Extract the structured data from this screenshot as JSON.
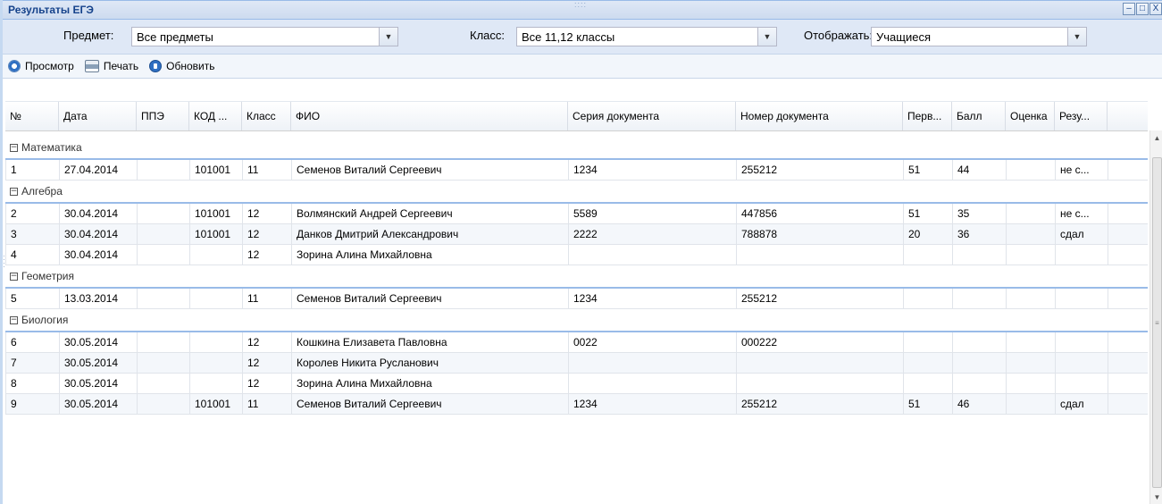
{
  "window": {
    "title": "Результаты ЕГЭ",
    "buttons": {
      "minimize": "–",
      "maximize": "□",
      "close": "X"
    }
  },
  "filters": {
    "subject_label": "Предмет:",
    "subject_value": "Все предметы",
    "class_label": "Класс:",
    "class_value": "Все 11,12 классы",
    "display_label": "Отображать:",
    "display_value": "Учащиеся"
  },
  "toolbar": {
    "view_label": "Просмотр",
    "print_label": "Печать",
    "refresh_label": "Обновить",
    "icons": {
      "view": "view-icon",
      "print": "printer-icon",
      "refresh": "refresh-icon"
    }
  },
  "columns": [
    "№",
    "Дата",
    "ППЭ",
    "КОД ...",
    "Класс",
    "ФИО",
    "Серия документа",
    "Номер документа",
    "Перв...",
    "Балл",
    "Оценка",
    "Резу..."
  ],
  "groups": [
    {
      "name": "Математика",
      "rows": [
        [
          "1",
          "27.04.2014",
          "",
          "101001",
          "11",
          "Семенов Виталий Сергеевич",
          "1234",
          "255212",
          "51",
          "44",
          "",
          "не с..."
        ]
      ]
    },
    {
      "name": "Алгебра",
      "rows": [
        [
          "2",
          "30.04.2014",
          "",
          "101001",
          "12",
          "Волмянский Андрей Сергеевич",
          "5589",
          "447856",
          "51",
          "35",
          "",
          "не с..."
        ],
        [
          "3",
          "30.04.2014",
          "",
          "101001",
          "12",
          "Данков Дмитрий Александрович",
          "2222",
          "788878",
          "20",
          "36",
          "",
          "сдал"
        ],
        [
          "4",
          "30.04.2014",
          "",
          "",
          "12",
          "Зорина Алина Михайловна",
          "",
          "",
          "",
          "",
          "",
          ""
        ]
      ]
    },
    {
      "name": "Геометрия",
      "rows": [
        [
          "5",
          "13.03.2014",
          "",
          "",
          "11",
          "Семенов Виталий Сергеевич",
          "1234",
          "255212",
          "",
          "",
          "",
          ""
        ]
      ]
    },
    {
      "name": "Биология",
      "rows": [
        [
          "6",
          "30.05.2014",
          "",
          "",
          "12",
          "Кошкина Елизавета Павловна",
          "0022",
          "000222",
          "",
          "",
          "",
          ""
        ],
        [
          "7",
          "30.05.2014",
          "",
          "",
          "12",
          "Королев Никита Русланович",
          "",
          "",
          "",
          "",
          "",
          ""
        ],
        [
          "8",
          "30.05.2014",
          "",
          "",
          "12",
          "Зорина Алина Михайловна",
          "",
          "",
          "",
          "",
          "",
          ""
        ],
        [
          "9",
          "30.05.2014",
          "",
          "101001",
          "11",
          "Семенов Виталий Сергеевич",
          "1234",
          "255212",
          "51",
          "46",
          "",
          "сдал"
        ]
      ]
    }
  ],
  "colors": {
    "accent": "#99bbe8",
    "title_text": "#15428b",
    "filter_bg": "#dfe8f6"
  }
}
